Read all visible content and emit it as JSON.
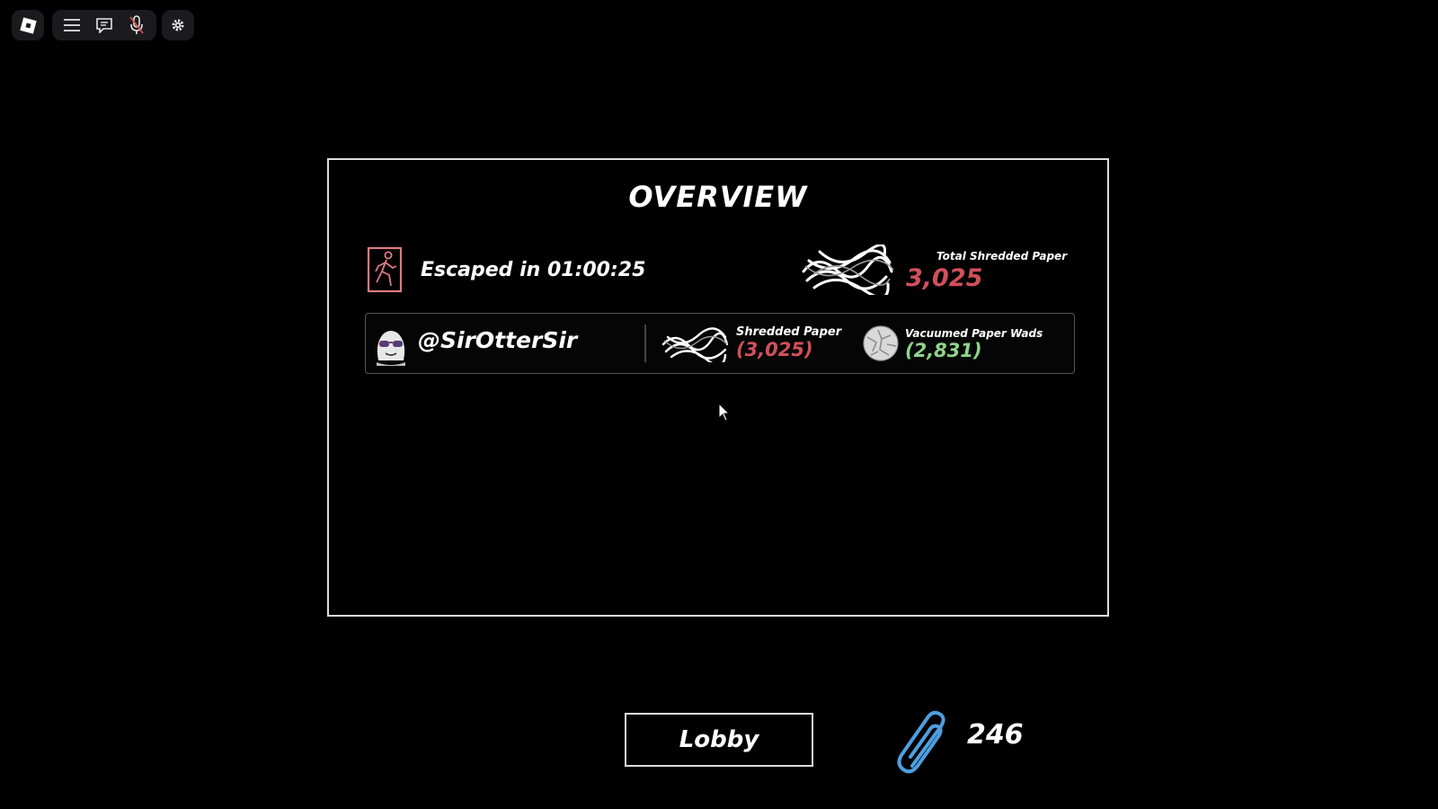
{
  "topbar": {
    "logo": "roblox-logo-icon",
    "menu_icon": "hamburger-menu-icon",
    "chat_icon": "chat-icon",
    "mic_icon": "microphone-icon",
    "settings_icon": "gear-icon"
  },
  "overview": {
    "title": "OVERVIEW",
    "escape_text": "Escaped in 01:00:25",
    "total_label": "Total Shredded Paper",
    "total_value": "3,025",
    "player": {
      "username": "@SirOtterSir",
      "shredded_label": "Shredded Paper",
      "shredded_value": "(3,025)",
      "wads_label": "Vacuumed Paper Wads",
      "wads_value": "(2,831)"
    }
  },
  "footer": {
    "lobby_label": "Lobby",
    "paperclip_count": "246"
  },
  "colors": {
    "accent_red": "#d0505b",
    "accent_green": "#8fd48a",
    "paperclip_blue": "#4f9fe0"
  }
}
